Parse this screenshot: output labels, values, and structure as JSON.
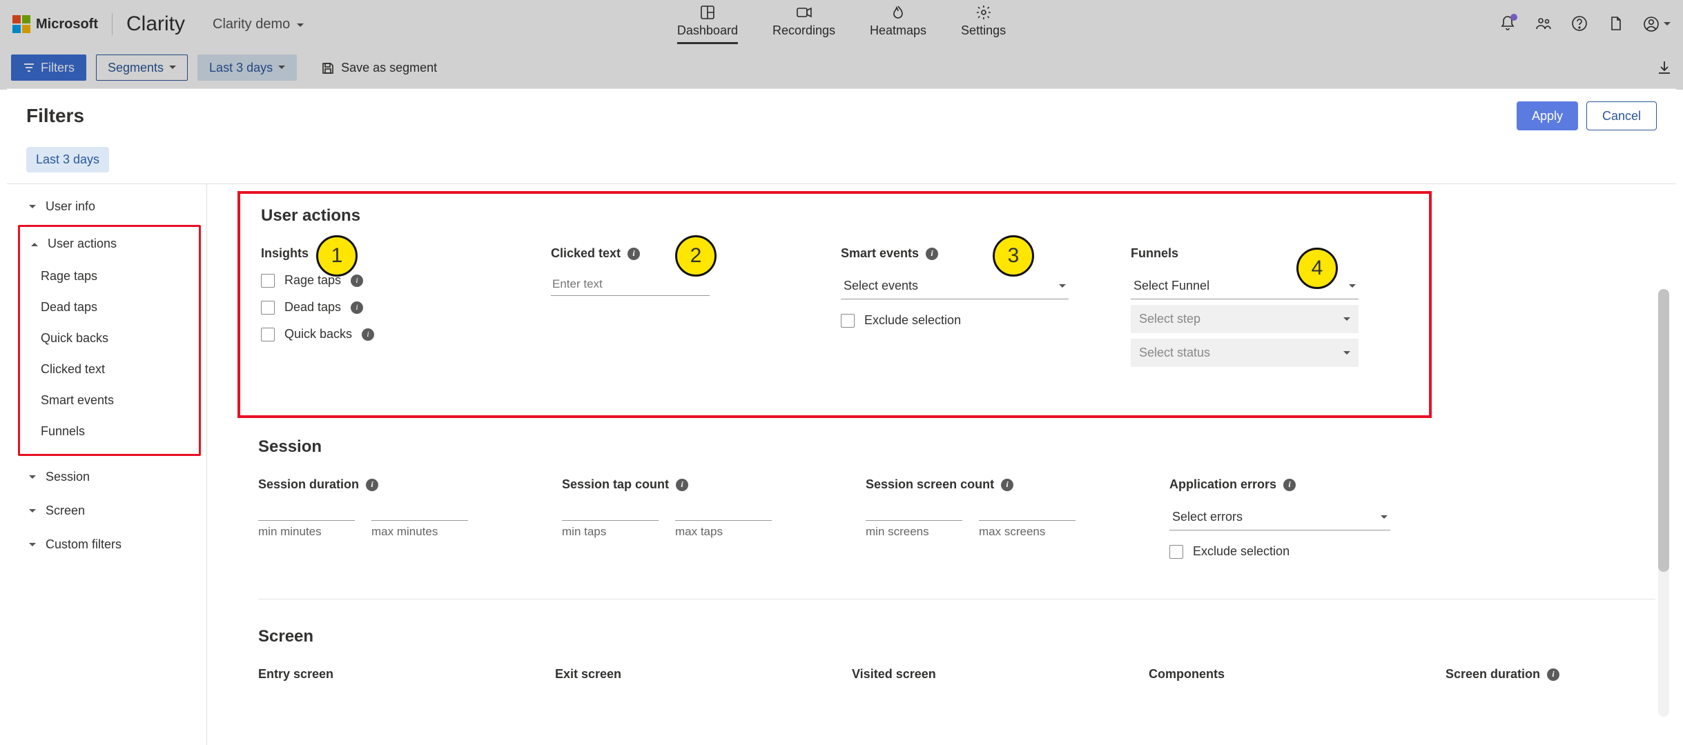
{
  "brand": {
    "ms": "Microsoft",
    "product": "Clarity",
    "project": "Clarity demo"
  },
  "topnav": {
    "dashboard": "Dashboard",
    "recordings": "Recordings",
    "heatmaps": "Heatmaps",
    "settings": "Settings"
  },
  "toolbar": {
    "filters": "Filters",
    "segments": "Segments",
    "last3": "Last 3 days",
    "save_segment": "Save as segment"
  },
  "dialog": {
    "title": "Filters",
    "apply": "Apply",
    "cancel": "Cancel",
    "chip_last3": "Last 3 days"
  },
  "sidebar": {
    "user_info": "User info",
    "user_actions": "User actions",
    "items": {
      "rage": "Rage taps",
      "dead": "Dead taps",
      "quick": "Quick backs",
      "clicked": "Clicked text",
      "smart": "Smart events",
      "funnels": "Funnels"
    },
    "session": "Session",
    "screen": "Screen",
    "custom": "Custom filters"
  },
  "user_actions": {
    "title": "User actions",
    "insights_h": "Insights",
    "rage": "Rage taps",
    "dead": "Dead taps",
    "quick": "Quick backs",
    "clicked_h": "Clicked text",
    "clicked_ph": "Enter text",
    "smart_h": "Smart events",
    "smart_sel": "Select events",
    "exclude": "Exclude selection",
    "funnels_h": "Funnels",
    "funnel_sel": "Select Funnel",
    "step_sel": "Select step",
    "status_sel": "Select status"
  },
  "session": {
    "title": "Session",
    "duration_h": "Session duration",
    "tap_h": "Session tap count",
    "screen_h": "Session screen count",
    "err_h": "Application errors",
    "min_min": "min minutes",
    "max_min": "max minutes",
    "min_tap": "min taps",
    "max_tap": "max taps",
    "min_scr": "min screens",
    "max_scr": "max screens",
    "err_sel": "Select errors",
    "exclude": "Exclude selection"
  },
  "screen": {
    "title": "Screen",
    "entry": "Entry screen",
    "exit": "Exit screen",
    "visited": "Visited screen",
    "components": "Components",
    "duration": "Screen duration"
  },
  "balloons": {
    "b1": "1",
    "b2": "2",
    "b3": "3",
    "b4": "4"
  }
}
